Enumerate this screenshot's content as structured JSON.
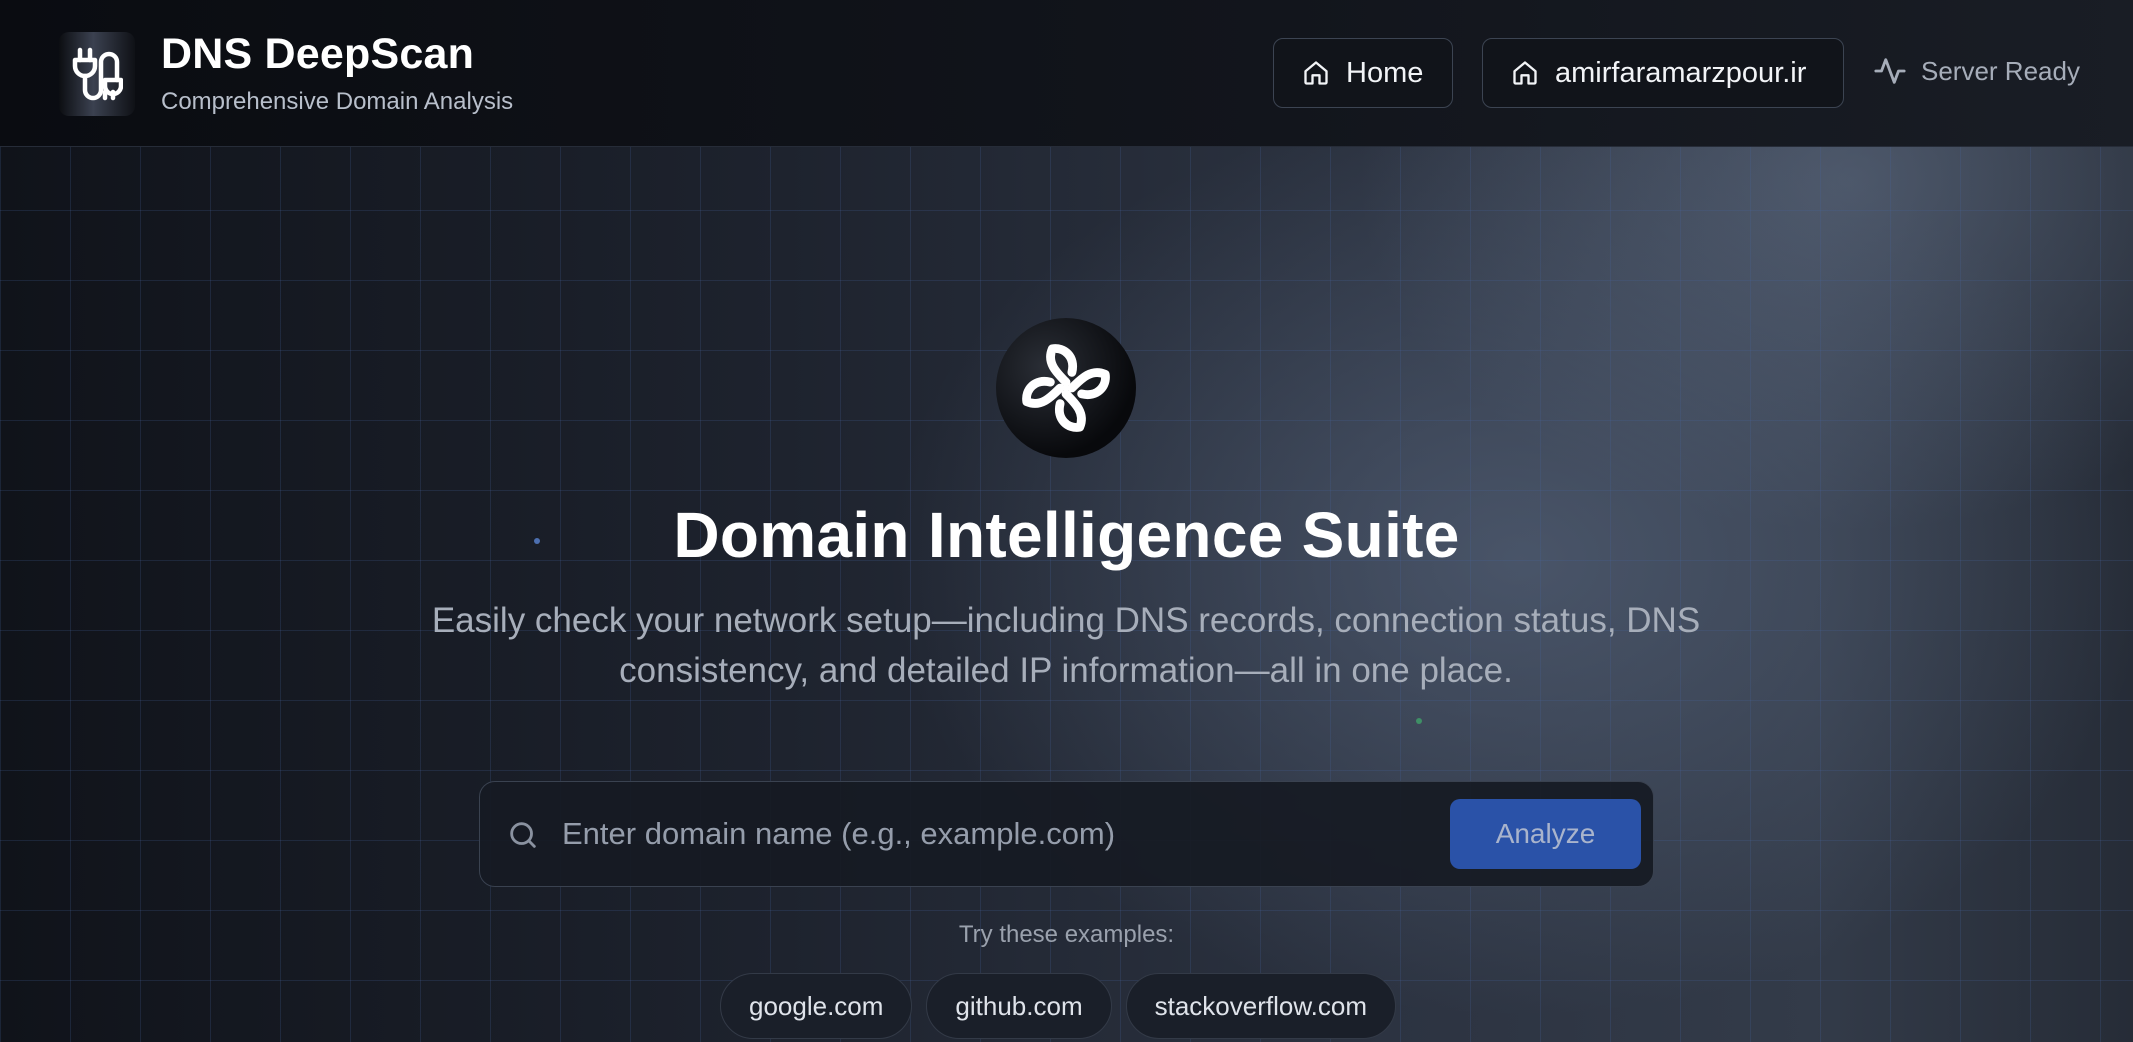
{
  "header": {
    "title": "DNS DeepScan",
    "subtitle": "Comprehensive Domain Analysis",
    "logo_icon": "plug-icon",
    "nav": [
      {
        "label": "Home",
        "icon": "home-icon"
      },
      {
        "label": "amirfaramarzpour.ir",
        "icon": "home-icon"
      }
    ],
    "status": {
      "label": "Server Ready",
      "icon": "activity-icon"
    }
  },
  "hero": {
    "logo_icon": "pinwheel-icon",
    "title": "Domain Intelligence Suite",
    "description": "Easily check your network setup—including DNS records, connection status, DNS consistency, and detailed IP information—all in one place."
  },
  "search": {
    "placeholder": "Enter domain name (e.g., example.com)",
    "value": "",
    "button_label": "Analyze"
  },
  "examples": {
    "label": "Try these examples:",
    "items": [
      "google.com",
      "github.com",
      "stackoverflow.com"
    ]
  },
  "colors": {
    "accent": "#2a52a8",
    "header_bg": "#0a0c11",
    "text_primary": "#ffffff",
    "text_muted": "#a7aeba"
  }
}
